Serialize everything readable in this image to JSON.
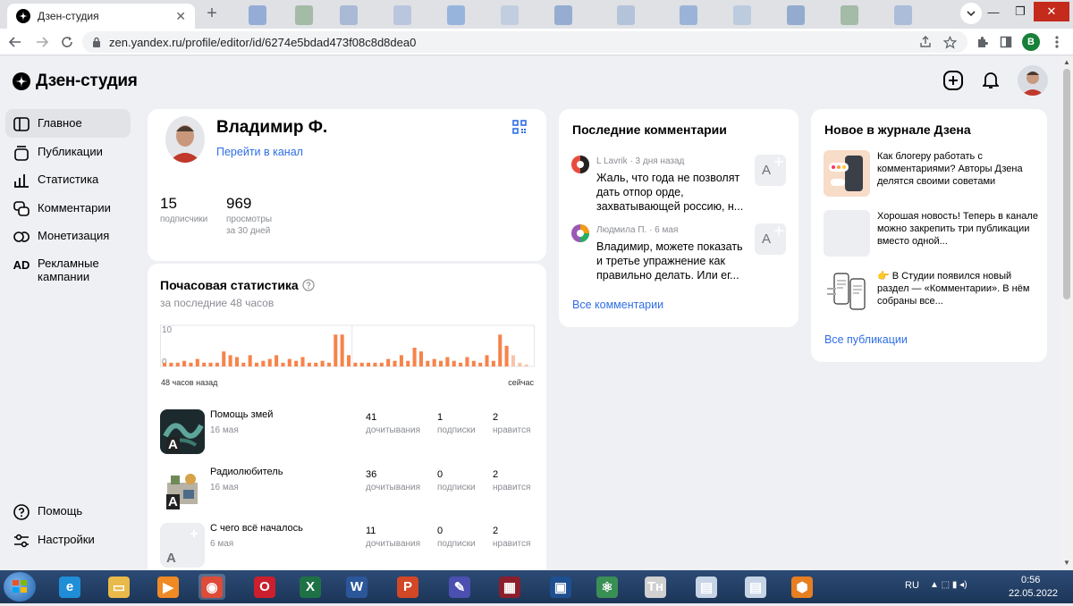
{
  "browser": {
    "tab_title": "Дзен-студия",
    "tab_close": "✕",
    "new_tab": "+",
    "url": "zen.yandex.ru/profile/editor/id/6274e5bdad473f08c8d8dea0",
    "profile_initial": "В"
  },
  "app": {
    "logo_text": "Дзен-студия",
    "nav": [
      {
        "label": "Главное",
        "icon": "home-icon",
        "active": true
      },
      {
        "label": "Публикации",
        "icon": "publications-icon"
      },
      {
        "label": "Статистика",
        "icon": "stats-icon"
      },
      {
        "label": "Комментарии",
        "icon": "comments-icon"
      },
      {
        "label": "Монетизация",
        "icon": "monetization-icon"
      },
      {
        "label": "Рекламные кампании",
        "icon": "ad-icon",
        "icon_text": "AD"
      }
    ],
    "nav_bottom": [
      {
        "label": "Помощь",
        "icon": "help-icon"
      },
      {
        "label": "Настройки",
        "icon": "settings-icon"
      }
    ]
  },
  "profile": {
    "name": "Владимир Ф.",
    "channel_link": "Перейти в канал",
    "subscribers_value": "15",
    "subscribers_label": "подписчики",
    "views_value": "969",
    "views_label_1": "просмотры",
    "views_label_2": "за 30 дней"
  },
  "hourly": {
    "title": "Почасовая статистика",
    "subtitle": "за последние 48 часов",
    "left_caption": "48 часов назад",
    "right_caption": "сейчас",
    "chart_data": {
      "type": "bar",
      "title": "Почасовая статистика",
      "ylim": [
        0,
        10
      ],
      "ytick_labels": [
        "10",
        "0"
      ],
      "values": [
        1,
        1,
        1,
        1.5,
        1,
        2,
        1,
        1,
        1,
        4,
        3,
        2.5,
        1,
        3,
        1,
        1.5,
        2,
        3,
        1,
        2,
        1.5,
        2.5,
        1,
        1,
        1.5,
        1,
        8.5,
        8.5,
        3,
        1,
        1,
        1,
        1,
        1,
        2,
        1.5,
        3,
        1.5,
        5,
        4,
        1.5,
        2,
        1.5,
        2.5,
        1.5,
        1,
        2.5,
        1.5,
        1,
        3,
        1.5,
        8.5,
        5.5,
        3,
        1,
        0.5
      ],
      "light_last": 3,
      "divider_index": 28
    },
    "posts": [
      {
        "title": "Помощь змей",
        "date": "16 мая",
        "reads": "41",
        "subs": "1",
        "likes": "2",
        "thumb": "snake"
      },
      {
        "title": "Радиолюбитель",
        "date": "16 мая",
        "reads": "36",
        "subs": "0",
        "likes": "2",
        "thumb": "radio"
      },
      {
        "title": "С чего всё началось",
        "date": "6 мая",
        "reads": "11",
        "subs": "0",
        "likes": "2",
        "thumb": "blank"
      }
    ],
    "reads_label": "дочитывания",
    "subs_label": "подписки",
    "likes_label": "нравится",
    "thumb_letter": "A"
  },
  "comments": {
    "title": "Последние комментарии",
    "items": [
      {
        "author": "L Lavrik",
        "time": "· 3 дня назад",
        "text": "Жаль, что года не позволят дать отпор орде, захватывающей россию, н..."
      },
      {
        "author": "Людмила П.",
        "time": "· 6 мая",
        "text": "Владимир, можете показать и третье упражнение как правильно делать. Или ег..."
      }
    ],
    "all_link": "Все комментарии",
    "thumb_letter": "A"
  },
  "journal": {
    "title": "Новое в журнале Дзена",
    "items": [
      {
        "text": "Как блогеру работать с комментариями? Авторы Дзена делятся своими советами"
      },
      {
        "text": "Хорошая новость! Теперь в канале можно закрепить три публикации вместо одной..."
      },
      {
        "text": "👉 В Студии появился новый раздел — «Комментарии». В нём собраны все..."
      }
    ],
    "all_link": "Все публикации"
  },
  "taskbar": {
    "lang": "RU",
    "time": "0:56",
    "date": "22.05.2022"
  },
  "colors": {
    "accent_link": "#2f6ee5",
    "bar": "#f7834a",
    "bar_light": "#f9c3a8"
  }
}
